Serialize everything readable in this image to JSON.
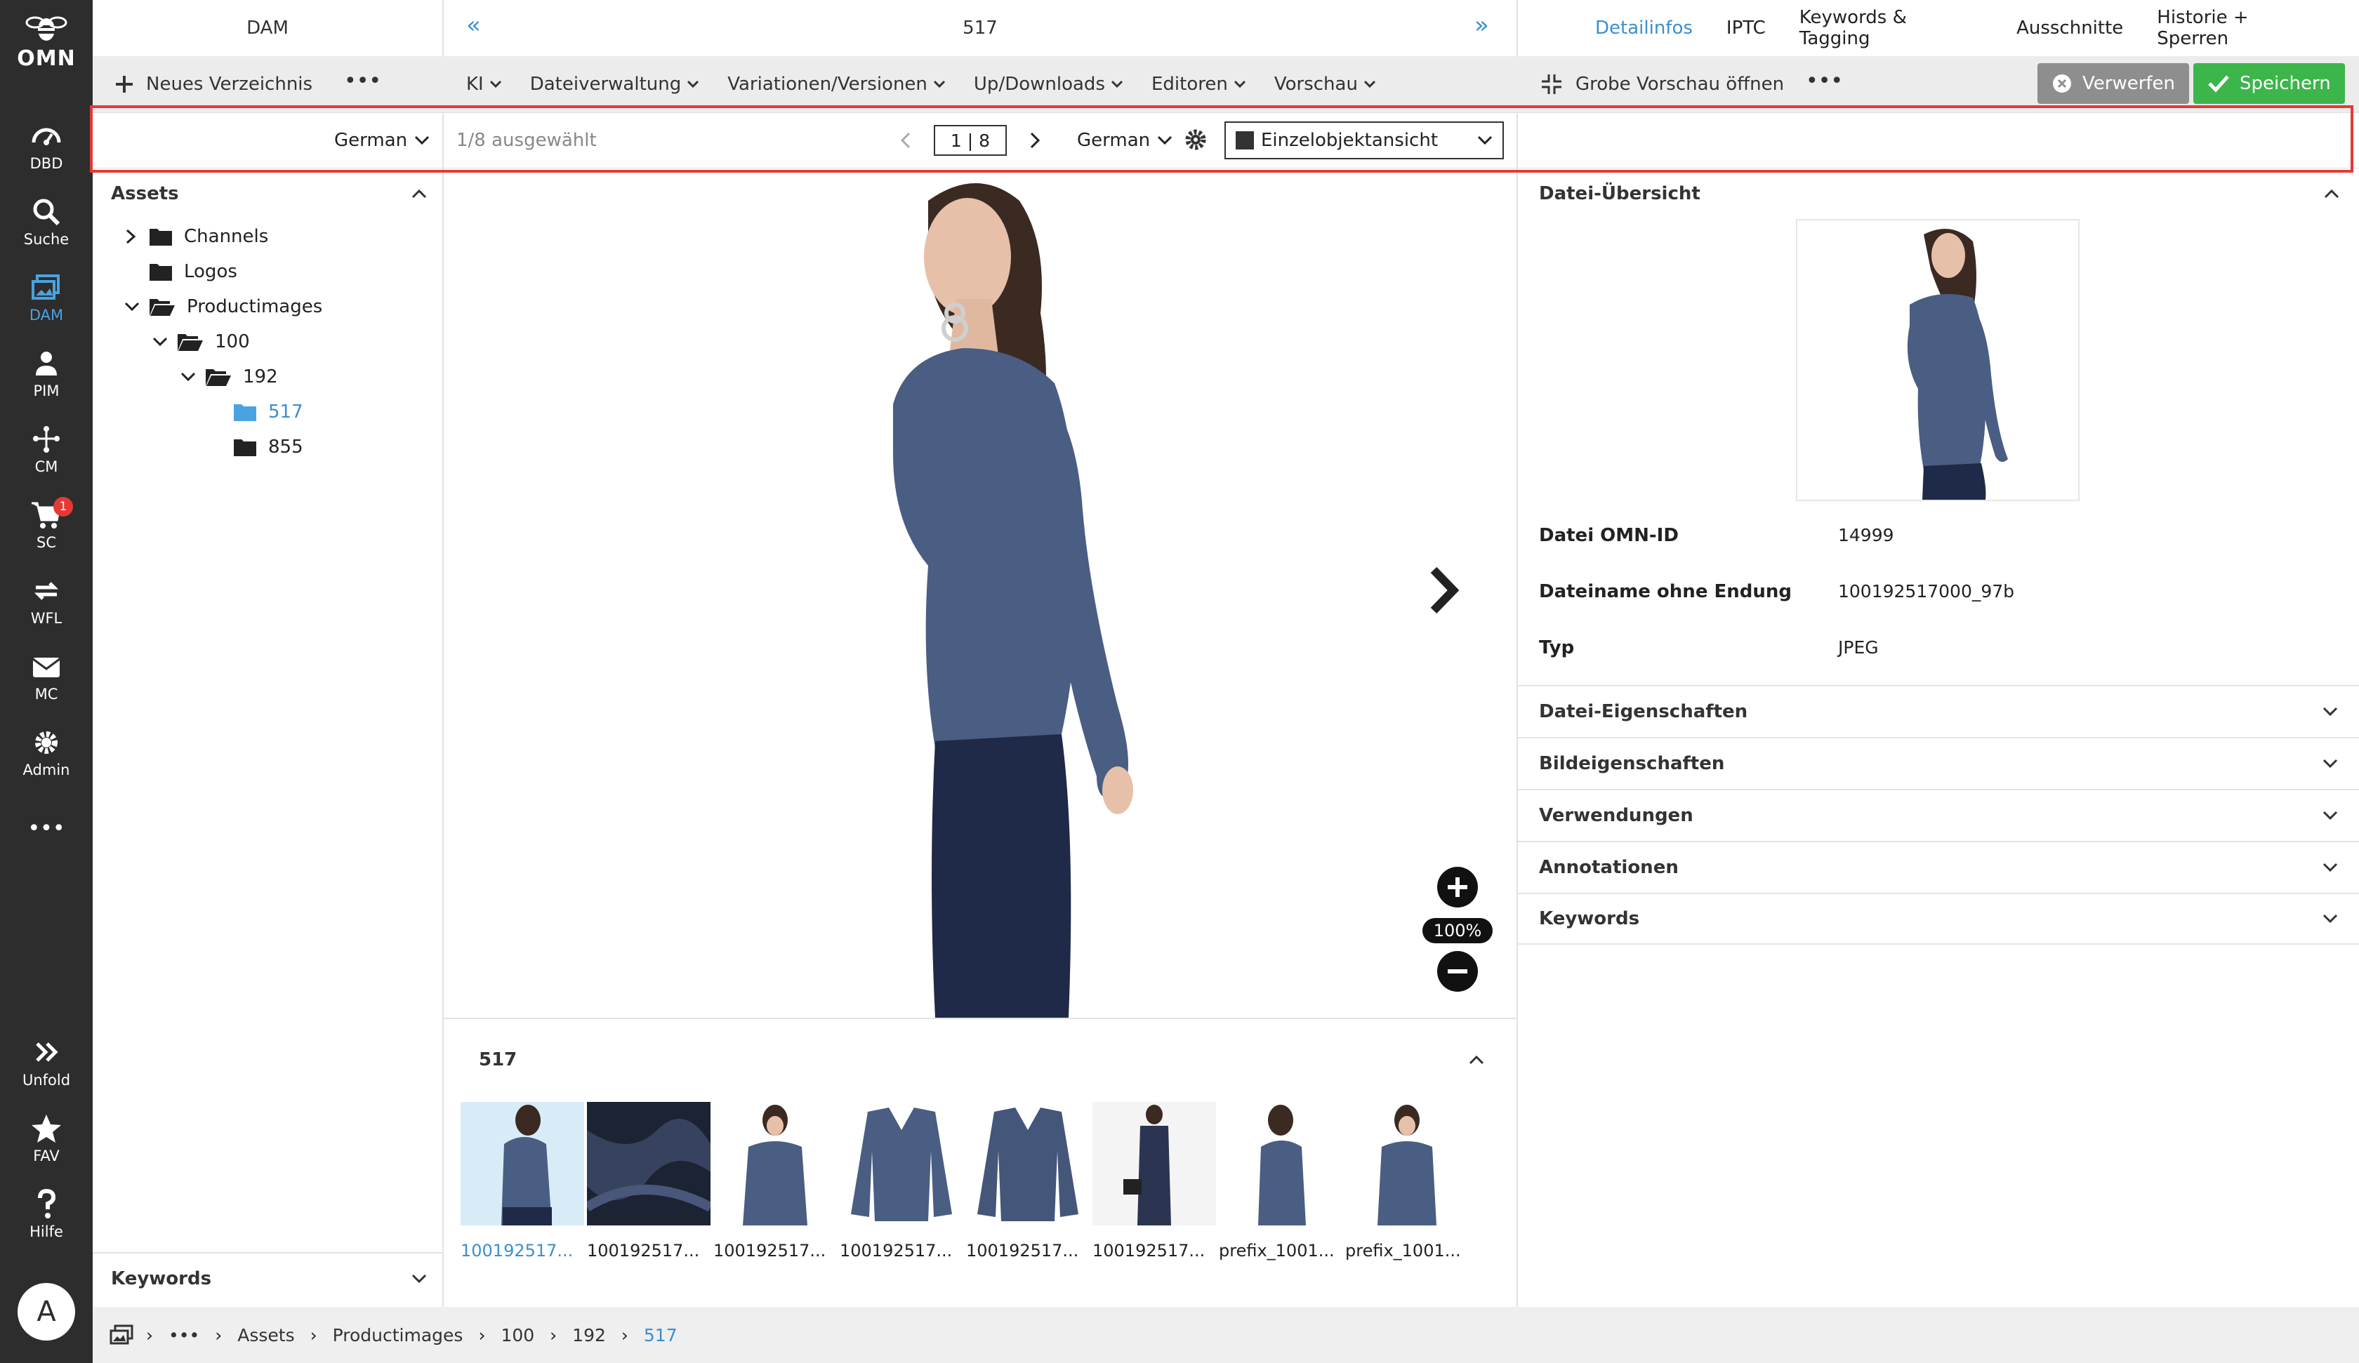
{
  "appnav": {
    "logo": "OMN",
    "items": [
      {
        "label": "DBD",
        "icon": "dashboard-icon"
      },
      {
        "label": "Suche",
        "icon": "search-icon"
      },
      {
        "label": "DAM",
        "icon": "image-gallery-icon"
      },
      {
        "label": "PIM",
        "icon": "pim-icon"
      },
      {
        "label": "CM",
        "icon": "network-icon"
      },
      {
        "label": "SC",
        "icon": "cart-icon",
        "badge": "1"
      },
      {
        "label": "WFL",
        "icon": "workflow-icon"
      },
      {
        "label": "MC",
        "icon": "mail-icon"
      },
      {
        "label": "Admin",
        "icon": "gear-icon"
      },
      {
        "label": "•••",
        "icon": "more-icon"
      }
    ],
    "bottom": [
      {
        "label": "Unfold",
        "icon": "unfold-icon"
      },
      {
        "label": "FAV",
        "icon": "star-icon"
      },
      {
        "label": "Hilfe",
        "icon": "help-icon"
      }
    ],
    "avatar": "A",
    "accent": "#4aa3df"
  },
  "left_panel": {
    "title": "DAM",
    "new_dir": "Neues Verzeichnis",
    "language": "German",
    "assets_title": "Assets",
    "keywords_title": "Keywords",
    "tree": [
      {
        "label": "Channels"
      },
      {
        "label": "Logos"
      },
      {
        "label": "Productimages"
      },
      {
        "label": "100"
      },
      {
        "label": "192"
      },
      {
        "label": "517"
      },
      {
        "label": "855"
      }
    ]
  },
  "center": {
    "title": "517",
    "menus": [
      "KI",
      "Dateiverwaltung",
      "Variationen/Versionen",
      "Up/Downloads",
      "Editoren",
      "Vorschau"
    ],
    "selection": "1/8 ausgewählt",
    "pager": "1 | 8",
    "language": "German",
    "view_mode": "Einzelobjektansicht",
    "zoom": "100%",
    "gallery_title": "517",
    "thumbs": [
      "100192517...",
      "100192517...",
      "100192517...",
      "100192517...",
      "100192517...",
      "100192517...",
      "prefix_1001...",
      "prefix_1001..."
    ]
  },
  "right_panel": {
    "tabs": [
      "Detailinfos",
      "IPTC",
      "Keywords & Tagging",
      "Ausschnitte",
      "Historie + Sperren"
    ],
    "preview_button": "Grobe Vorschau öffnen",
    "discard": "Verwerfen",
    "save": "Speichern",
    "overview_title": "Datei-Übersicht",
    "fields": [
      {
        "label": "Datei OMN-ID",
        "value": "14999"
      },
      {
        "label": "Dateiname ohne Endung",
        "value": "100192517000_97b"
      },
      {
        "label": "Typ",
        "value": "JPEG"
      }
    ],
    "accordions": [
      "Datei-Eigenschaften",
      "Bildeigenschaften",
      "Verwendungen",
      "Annotationen",
      "Keywords"
    ]
  },
  "breadcrumb": [
    "•••",
    "Assets",
    "Productimages",
    "100",
    "192",
    "517"
  ],
  "colors": {
    "primary": "#3b8fd0",
    "save": "#3cb54a",
    "discard": "#8e8e8e",
    "highlight": "#e53935"
  }
}
